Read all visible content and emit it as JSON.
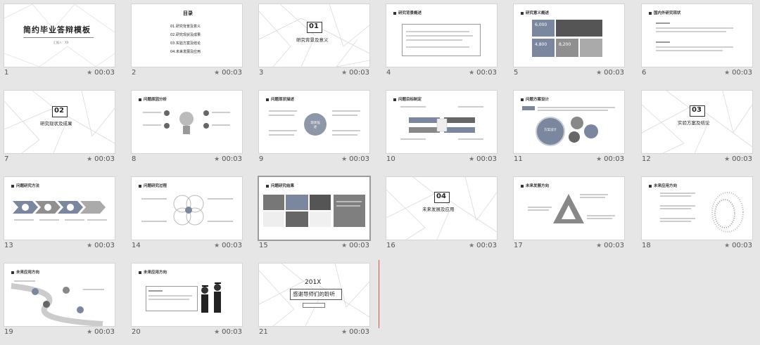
{
  "slides": [
    {
      "number": "1",
      "time": "00:03",
      "title": "简约毕业答辩模板",
      "subtitle": "汇报人：XX"
    },
    {
      "number": "2",
      "time": "00:03",
      "heading": "目录",
      "items": [
        "01.研究背景及意义",
        "02.研究现状及成果",
        "03.实验方案及结论",
        "04.未来发展及应用"
      ]
    },
    {
      "number": "3",
      "time": "00:03",
      "chapter": "01",
      "caption": "研究背景及意义"
    },
    {
      "number": "4",
      "time": "00:03",
      "header": "研究背景概述"
    },
    {
      "number": "5",
      "time": "00:03",
      "header": "研究意义概述",
      "stats": [
        "6,000",
        "4,800",
        "8,200"
      ]
    },
    {
      "number": "6",
      "time": "00:03",
      "header": "国内外研究现状"
    },
    {
      "number": "7",
      "time": "00:03",
      "chapter": "02",
      "caption": "研究现状及成果"
    },
    {
      "number": "8",
      "time": "00:03",
      "header": "问题原因分析"
    },
    {
      "number": "9",
      "time": "00:03",
      "header": "问题现状描述",
      "center": "现状描述"
    },
    {
      "number": "10",
      "time": "00:03",
      "header": "问题目标制定"
    },
    {
      "number": "11",
      "time": "00:03",
      "header": "问题方案设计",
      "center": "方案设计"
    },
    {
      "number": "12",
      "time": "00:03",
      "chapter": "03",
      "caption": "实验方案及结论"
    },
    {
      "number": "13",
      "time": "00:03",
      "header": "问题研究方法"
    },
    {
      "number": "14",
      "time": "00:03",
      "header": "问题研究过程"
    },
    {
      "number": "15",
      "time": "00:03",
      "header": "问题研究结果"
    },
    {
      "number": "16",
      "time": "00:03",
      "chapter": "04",
      "caption": "未来发展及应用"
    },
    {
      "number": "17",
      "time": "00:03",
      "header": "未来发展方向"
    },
    {
      "number": "18",
      "time": "00:03",
      "header": "未来应用方向"
    },
    {
      "number": "19",
      "time": "00:03",
      "header": "未来应用方向"
    },
    {
      "number": "20",
      "time": "00:03",
      "header": "未来应用方向"
    },
    {
      "number": "21",
      "time": "00:03",
      "title": "201X",
      "subtitle": "感谢导师们的聆听"
    }
  ],
  "selected_slide": "15",
  "colors": {
    "background": "#e6e6e6",
    "accent": "#7b879e",
    "selection": "#9c9c9c",
    "insert_marker": "#d9534f"
  }
}
